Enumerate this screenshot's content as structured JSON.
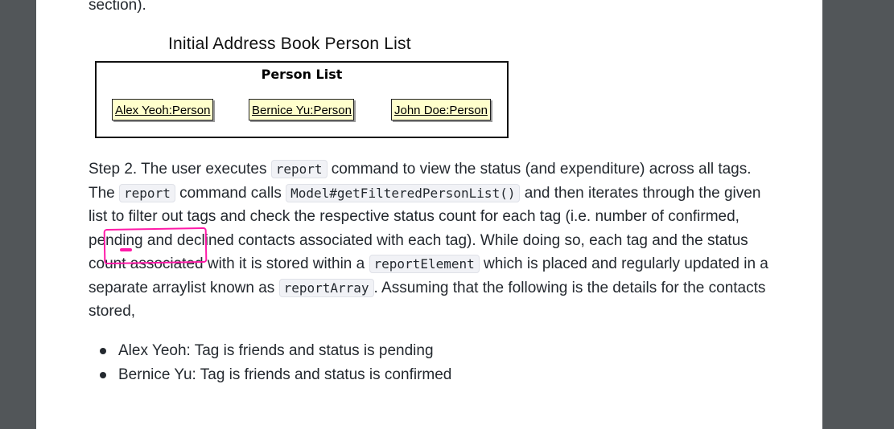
{
  "document": {
    "prev_text": "section).",
    "diagram": {
      "title": "Initial Address Book Person List",
      "box_title": "Person List",
      "persons": [
        "Alex Yeoh:Person",
        "Bernice Yu:Person",
        "John Doe:Person"
      ]
    },
    "paragraph": {
      "t1": "Step 2. The user executes ",
      "c1": "report",
      "t2": " command to view the status (and expenditure) across all tags. The ",
      "c2": "report",
      "t3": " command calls ",
      "c3": "Model#getFilteredPersonList()",
      "t4": " and then iterates through the given list to filter out tags and check the respective status count for each tag (i.e. number of confirmed, pending and declined contacts associated with each tag). While doing so, each tag and the status count associated with it is stored within a ",
      "c4": "reportElement",
      "t5": " which is placed and regularly updated in a separate arraylist known as ",
      "c5": "reportArray",
      "t6": ". Assuming that the following is the details for the contacts stored,"
    },
    "bullets": [
      "Alex Yeoh: Tag is friends and status is pending",
      "Bernice Yu: Tag is friends and status is confirmed"
    ]
  },
  "colors": {
    "viewer_background": "#525659",
    "page": "#ffffff",
    "person_fill": "#ffffcc",
    "annotation": "#ff1aa8"
  }
}
